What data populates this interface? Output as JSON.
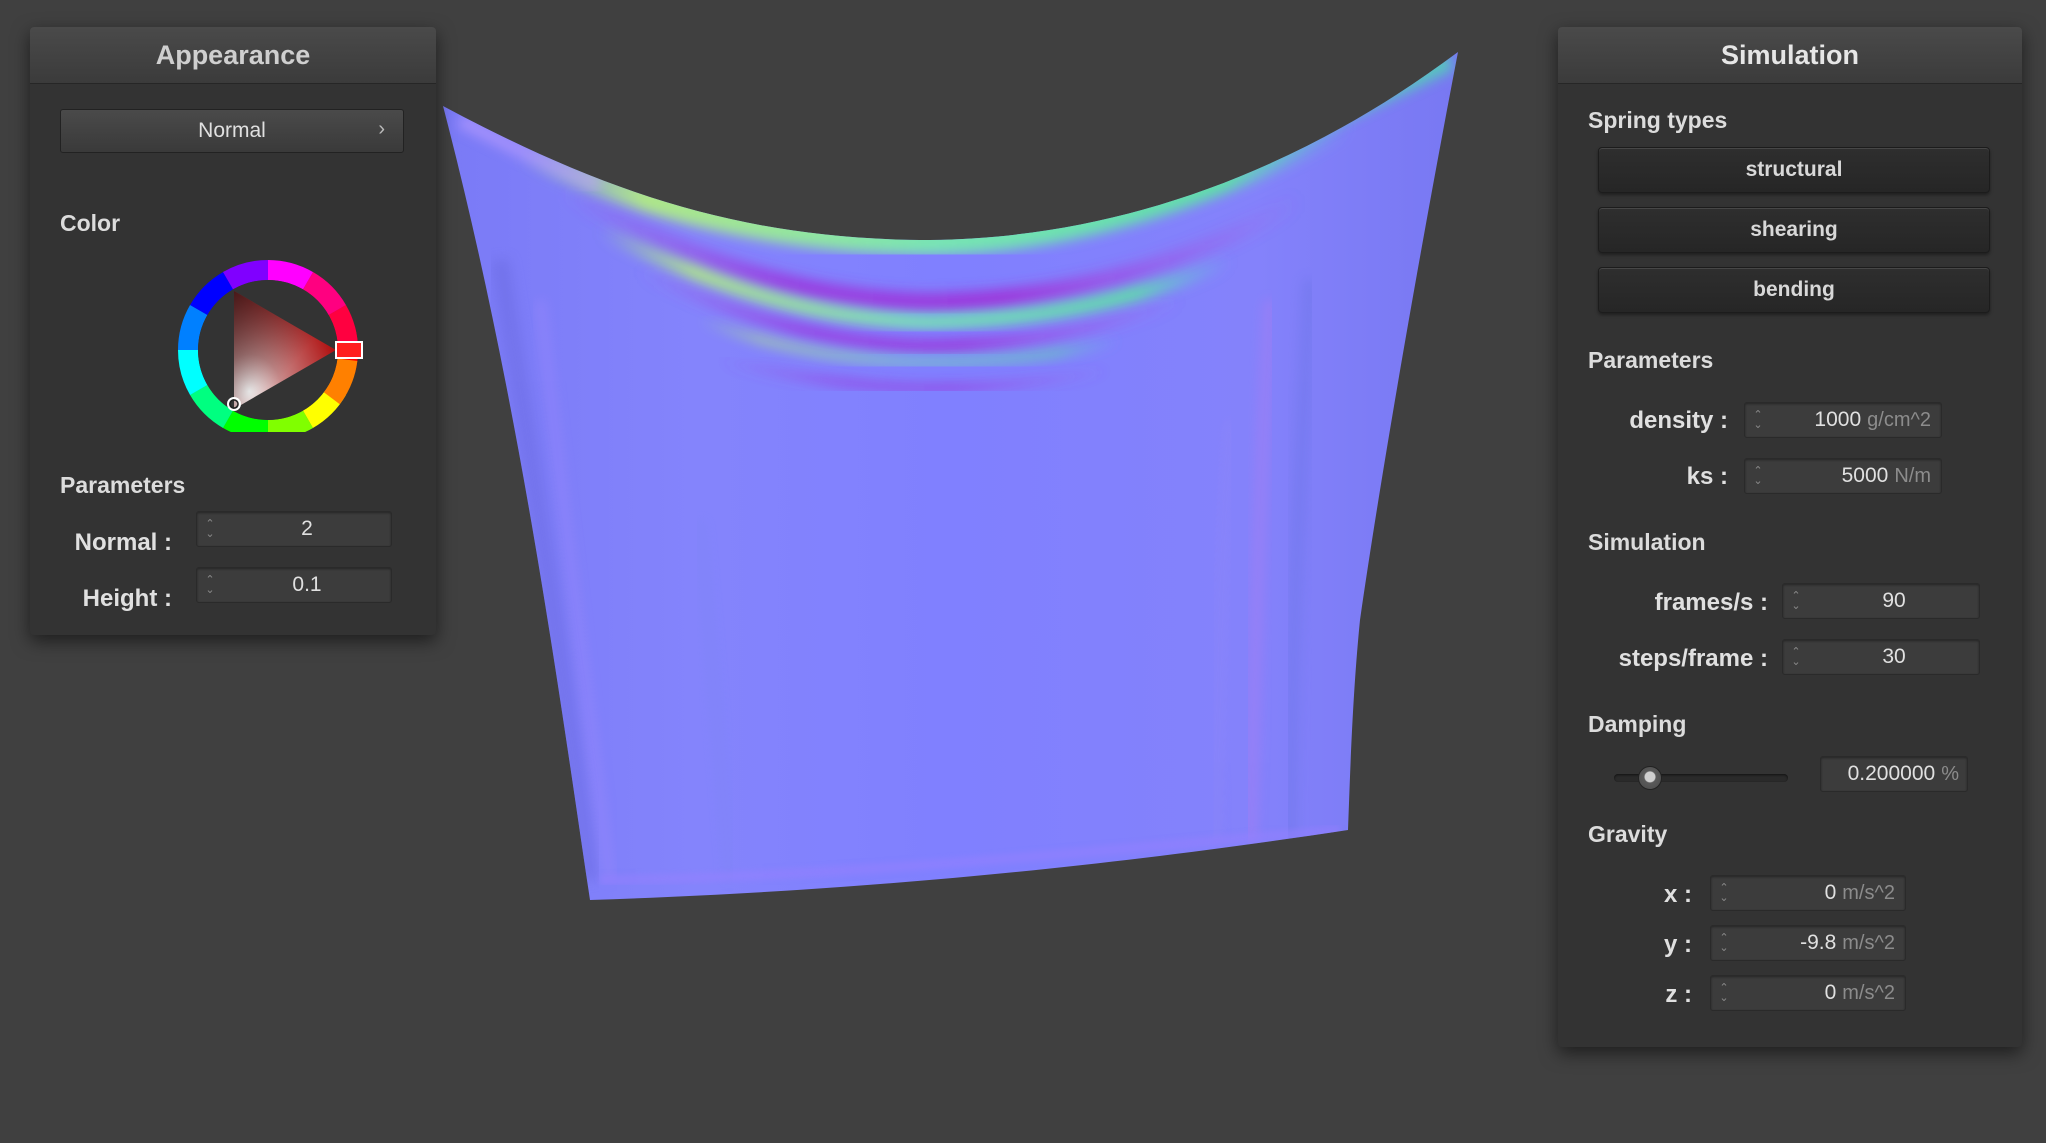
{
  "appearance": {
    "title": "Appearance",
    "mode_dropdown": {
      "value": "Normal",
      "icon": "chevron-right-icon"
    },
    "color_label": "Color",
    "color_picker": {
      "selected_hue": "#ff0000",
      "base_color": "#b01010"
    },
    "parameters_label": "Parameters",
    "normal": {
      "label": "Normal :",
      "value": "2"
    },
    "height": {
      "label": "Height :",
      "value": "0.1"
    }
  },
  "simulation": {
    "title": "Simulation",
    "spring_types_label": "Spring types",
    "spring_buttons": [
      "structural",
      "shearing",
      "bending"
    ],
    "parameters_label": "Parameters",
    "density": {
      "label": "density :",
      "value": "1000",
      "unit": "g/cm^2"
    },
    "ks": {
      "label": "ks :",
      "value": "5000",
      "unit": "N/m"
    },
    "simulation_label": "Simulation",
    "fps": {
      "label": "frames/s :",
      "value": "90"
    },
    "steps": {
      "label": "steps/frame :",
      "value": "30"
    },
    "damping_label": "Damping",
    "damping": {
      "value": "0.200000",
      "unit": "%",
      "slider_fraction": 0.2
    },
    "gravity_label": "Gravity",
    "gravity_x": {
      "label": "x :",
      "value": "0",
      "unit": "m/s^2"
    },
    "gravity_y": {
      "label": "y :",
      "value": "-9.8",
      "unit": "m/s^2"
    },
    "gravity_z": {
      "label": "z :",
      "value": "0",
      "unit": "m/s^2"
    }
  },
  "theme": {
    "background": "#404040",
    "panel": "#333333",
    "cloth_base": "#8080ff"
  }
}
